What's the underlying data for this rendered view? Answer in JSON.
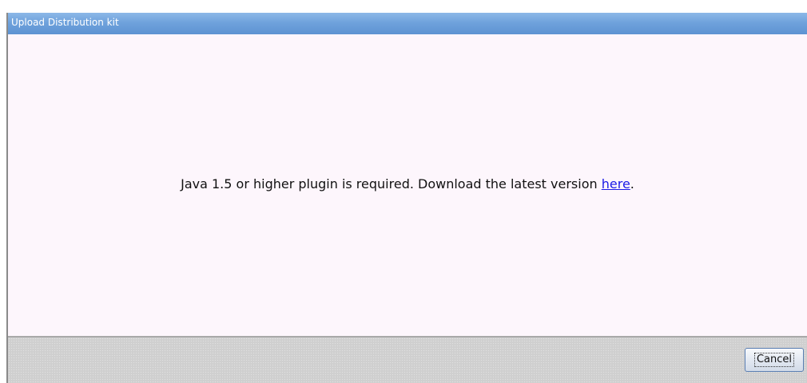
{
  "dialog": {
    "title": "Upload Distribution kit"
  },
  "content": {
    "message_prefix": "Java 1.5 or higher plugin is required. Download the latest version ",
    "link_text": "here",
    "message_suffix": "."
  },
  "footer": {
    "cancel_label": "Cancel"
  },
  "colors": {
    "title_bar": "#6fa2dc",
    "content_background": "#fdf6fc",
    "footer_background": "#cfcfcf",
    "link": "#1a1ae6"
  }
}
